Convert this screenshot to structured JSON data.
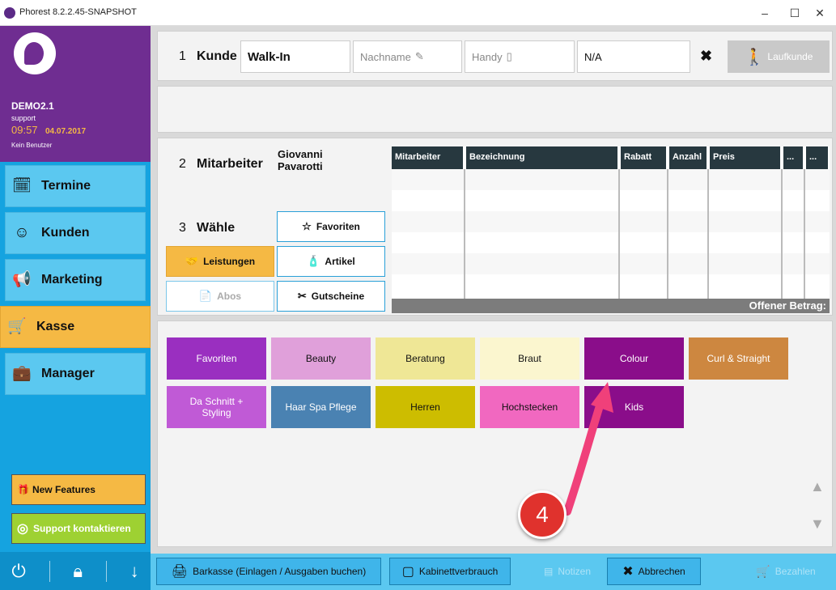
{
  "window": {
    "title": "Phorest 8.2.2.45-SNAPSHOT",
    "min": "–",
    "max": "☐",
    "close": "✕"
  },
  "sidebar": {
    "account": "DEMO2.1",
    "user": "support",
    "time": "09:57",
    "date": "04.07.2017",
    "no_user": "Kein Benutzer",
    "nav": [
      {
        "label": "Termine",
        "icon": "calendar-icon",
        "glyph": "🗓"
      },
      {
        "label": "Kunden",
        "icon": "client-head-icon",
        "glyph": "☺"
      },
      {
        "label": "Marketing",
        "icon": "megaphone-icon",
        "glyph": "📢"
      },
      {
        "label": "Kasse",
        "icon": "cart-icon",
        "glyph": "🛒"
      },
      {
        "label": "Manager",
        "icon": "briefcase-icon",
        "glyph": "💼"
      }
    ],
    "new_features": "New Features",
    "support": "Support kontaktieren"
  },
  "customer": {
    "step": "1",
    "label": "Kunde",
    "first_name": "Walk-In",
    "last_name_placeholder": "Nachname",
    "phone_placeholder": "Handy",
    "na": "N/A",
    "walkin_btn": "Laufkunde"
  },
  "staff": {
    "step": "2",
    "label": "Mitarbeiter",
    "name": "Giovanni Pavarotti"
  },
  "choose": {
    "step": "3",
    "label": "Wähle",
    "favoriten": "Favoriten",
    "leistungen": "Leistungen",
    "artikel": "Artikel",
    "abos": "Abos",
    "gutscheine": "Gutscheine"
  },
  "table": {
    "headers": [
      "Mitarbeiter",
      "Bezeichnung",
      "Rabatt",
      "Anzahl",
      "Preis",
      "...",
      "..."
    ],
    "footer": "Offener Betrag:"
  },
  "categories": [
    {
      "label": "Favoriten",
      "color": "#9a2fc0",
      "white": true
    },
    {
      "label": "Beauty",
      "color": "#e0a0da",
      "white": false
    },
    {
      "label": "Beratung",
      "color": "#efe796",
      "white": false
    },
    {
      "label": "Braut",
      "color": "#fbf6cf",
      "white": false
    },
    {
      "label": "Colour",
      "color": "#8a0d8a",
      "white": true
    },
    {
      "label": "Curl & Straight",
      "color": "#cd8740",
      "white": true
    },
    {
      "label": "Da Schnitt + Styling",
      "color": "#c05ad6",
      "white": true
    },
    {
      "label": "Haar Spa Pflege",
      "color": "#4a82b2",
      "white": true
    },
    {
      "label": "Herren",
      "color": "#cdbd00",
      "white": false
    },
    {
      "label": "Hochstecken",
      "color": "#f168c0",
      "white": false
    },
    {
      "label": "Kids",
      "color": "#8a0d8a",
      "white": true
    }
  ],
  "annotation": {
    "number": "4"
  },
  "footer": {
    "barkasse": "Barkasse (Einlagen / Ausgaben buchen)",
    "kabinett": "Kabinettverbrauch",
    "notizen": "Notizen",
    "abbrechen": "Abbrechen",
    "bezahlen": "Bezahlen"
  }
}
